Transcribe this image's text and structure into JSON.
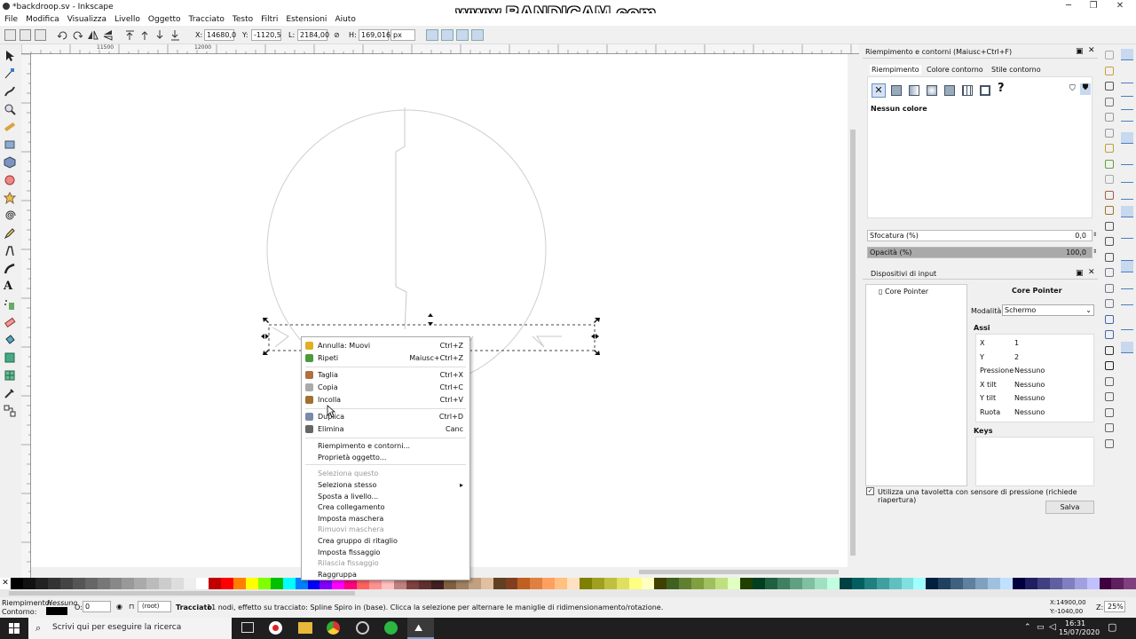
{
  "window": {
    "title": "*backdroop.sv - Inkscape",
    "watermark": "www.BANDICAM.com",
    "controls": {
      "minimize": "─",
      "maximize": "❐",
      "close": "✕"
    }
  },
  "menubar": [
    "File",
    "Modifica",
    "Visualizza",
    "Livello",
    "Oggetto",
    "Tracciato",
    "Testo",
    "Filtri",
    "Estensioni",
    "Aiuto"
  ],
  "toolbar": {
    "x_label": "X:",
    "x": "14680,0",
    "y_label": "Y:",
    "y": "-1120,5",
    "w_label": "L:",
    "w": "2184,00",
    "h_label": "H:",
    "h": "169,016",
    "unit": "px"
  },
  "ruler": {
    "label_a": "11500",
    "label_b": "12000"
  },
  "fill_panel": {
    "title": "Riempimento e contorni (Maiusc+Ctrl+F)",
    "tabs": [
      "Riempimento",
      "Colore contorno",
      "Stile contorno"
    ],
    "no_color": "Nessun colore",
    "blur_label": "Sfocatura (%)",
    "blur_value": "0,0",
    "opacity_label": "Opacità (%)",
    "opacity_value": "100,0",
    "opacity_level": 1.0
  },
  "input_panel": {
    "title": "Dispositivi di input",
    "device": "Core Pointer",
    "device_header": "Core Pointer",
    "mode_label": "Modalità:",
    "mode_value": "Schermo",
    "axes_label": "Assi",
    "axes": [
      [
        "X",
        "1"
      ],
      [
        "Y",
        "2"
      ],
      [
        "Pressione",
        "Nessuno"
      ],
      [
        "X tilt",
        "Nessuno"
      ],
      [
        "Y tilt",
        "Nessuno"
      ],
      [
        "Ruota",
        "Nessuno"
      ]
    ],
    "keys_label": "Keys",
    "tablet_checkbox": "Utilizza una tavoletta con sensore di pressione (richiede riapertura)",
    "save_button": "Salva"
  },
  "context_menu": {
    "items": [
      {
        "label": "Annulla: Muovi",
        "shortcut": "Ctrl+Z",
        "disabled": false,
        "icon": "undo-icon",
        "color": "#e0b020"
      },
      {
        "label": "Ripeti",
        "shortcut": "Maiusc+Ctrl+Z",
        "disabled": false,
        "icon": "redo-icon",
        "color": "#4a9a3a"
      },
      {
        "label": "Taglia",
        "shortcut": "Ctrl+X",
        "disabled": false,
        "icon": "cut-icon",
        "color": "#b07040"
      },
      {
        "label": "Copia",
        "shortcut": "Ctrl+C",
        "disabled": false,
        "icon": "copy-icon",
        "color": "#aaaaaa"
      },
      {
        "label": "Incolla",
        "shortcut": "Ctrl+V",
        "disabled": false,
        "icon": "paste-icon",
        "color": "#a07030"
      },
      {
        "label": "Duplica",
        "shortcut": "Ctrl+D",
        "disabled": false,
        "icon": "duplicate-icon",
        "color": "#7a8aa8"
      },
      {
        "label": "Elimina",
        "shortcut": "Canc",
        "disabled": false,
        "icon": "trash-icon",
        "color": "#666666"
      },
      {
        "label": "Riempimento e contorni...",
        "shortcut": "",
        "disabled": false
      },
      {
        "label": "Proprietà oggetto...",
        "shortcut": "",
        "disabled": false
      },
      {
        "label": "Seleziona questo",
        "shortcut": "",
        "disabled": true
      },
      {
        "label": "Seleziona stesso",
        "shortcut": "▸",
        "disabled": false
      },
      {
        "label": "Sposta a livello...",
        "shortcut": "",
        "disabled": false
      },
      {
        "label": "Crea collegamento",
        "shortcut": "",
        "disabled": false
      },
      {
        "label": "Imposta maschera",
        "shortcut": "",
        "disabled": false
      },
      {
        "label": "Rimuovi maschera",
        "shortcut": "",
        "disabled": true
      },
      {
        "label": "Crea gruppo di ritaglio",
        "shortcut": "",
        "disabled": false
      },
      {
        "label": "Imposta fissaggio",
        "shortcut": "",
        "disabled": false
      },
      {
        "label": "Rilascia fissaggio",
        "shortcut": "",
        "disabled": true
      },
      {
        "label": "Raggruppa",
        "shortcut": "",
        "disabled": false
      }
    ]
  },
  "palette": [
    "#000000",
    "#111111",
    "#222222",
    "#333333",
    "#444444",
    "#555555",
    "#666666",
    "#777777",
    "#888888",
    "#999999",
    "#aaaaaa",
    "#bbbbbb",
    "#cccccc",
    "#dddddd",
    "#eeeeee",
    "#ffffff",
    "#c00000",
    "#ff0000",
    "#ff8000",
    "#ffff00",
    "#80ff00",
    "#00c000",
    "#00ffff",
    "#0080ff",
    "#0000ff",
    "#8000ff",
    "#ff00ff",
    "#ff0080",
    "#ff6060",
    "#ff9090",
    "#ffc0c0",
    "#c08080",
    "#804040",
    "#603030",
    "#402020",
    "#806040",
    "#a08060",
    "#c0a080",
    "#e0c0a0",
    "#604020",
    "#804020",
    "#c06020",
    "#e08040",
    "#ffa060",
    "#ffc080",
    "#ffe0c0",
    "#808000",
    "#a0a020",
    "#c0c040",
    "#e0e060",
    "#ffff80",
    "#ffffc0",
    "#404000",
    "#406020",
    "#608030",
    "#80a040",
    "#a0c060",
    "#c0e080",
    "#e0ffc0",
    "#204000",
    "#004020",
    "#206040",
    "#408060",
    "#60a080",
    "#80c0a0",
    "#a0e0c0",
    "#c0ffe0",
    "#004040",
    "#006060",
    "#208080",
    "#40a0a0",
    "#60c0c0",
    "#80e0e0",
    "#a0ffff",
    "#002040",
    "#204060",
    "#406080",
    "#6080a0",
    "#80a0c0",
    "#a0c0e0",
    "#c0e0ff",
    "#000040",
    "#202060",
    "#404080",
    "#6060a0",
    "#8080c0",
    "#a0a0e0",
    "#c0c0ff",
    "#400040",
    "#602060",
    "#804080"
  ],
  "statusbar": {
    "fill_label": "Riempimento:",
    "fill_value": "Nessuno",
    "stroke_label": "Contorno:",
    "opacity_label": "O:",
    "opacity_value": "0",
    "layer": "(root)",
    "message_bold": "Tracciato",
    "message": " 11 nodi, effetto su tracciato: Spline Spiro in (base). Clicca la selezione per alternare le maniglie di ridimensionamento/rotazione.",
    "coord_x": "X:14900,00",
    "coord_y": "Y:-1040,00",
    "zoom_label": "Z:",
    "zoom": "25%"
  },
  "taskbar": {
    "search": "Scrivi qui per eseguire la ricerca",
    "time": "16:31",
    "date": "15/07/2020"
  }
}
